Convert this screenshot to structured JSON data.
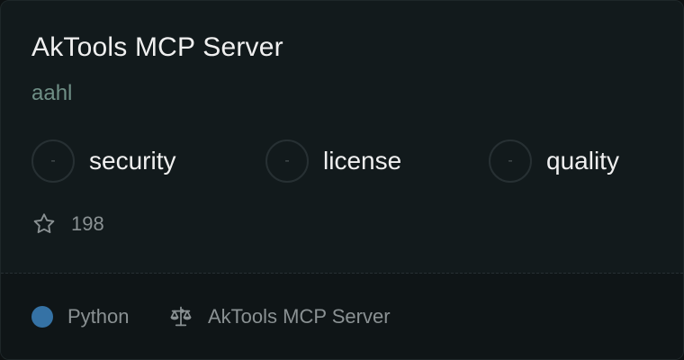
{
  "card": {
    "title": "AkTools MCP Server",
    "author": "aahl",
    "badges": [
      {
        "value": "-",
        "label": "security"
      },
      {
        "value": "-",
        "label": "license"
      },
      {
        "value": "-",
        "label": "quality"
      }
    ],
    "stars": "198",
    "footer": {
      "language": "Python",
      "language_color": "#3572A5",
      "license_text": "AkTools MCP Server"
    }
  },
  "icons": {
    "star": "star-icon",
    "license": "scale-icon"
  }
}
